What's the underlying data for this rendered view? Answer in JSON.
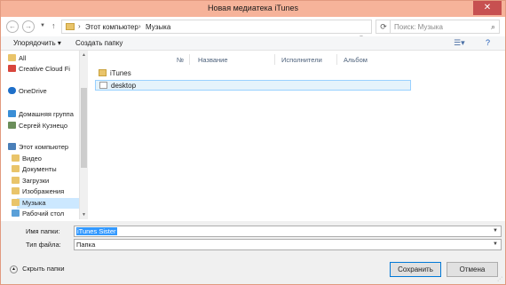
{
  "window": {
    "title": "Новая медиатека iTunes",
    "close_label": "✕"
  },
  "address": {
    "back_icon": "←",
    "forward_icon": "→",
    "breadcrumb": [
      "Этот компьютер",
      "Музыка"
    ],
    "separator": "›",
    "search_placeholder": "Поиск: Музыка"
  },
  "toolbar": {
    "organize_label": "Упорядочить ▾",
    "new_folder_label": "Создать папку"
  },
  "sidebar": {
    "items": [
      {
        "label": "All",
        "icon": "folder-icon"
      },
      {
        "label": "Creative Cloud Fi",
        "icon": "cloud-icon"
      },
      {
        "label": "OneDrive",
        "icon": "onedrive-icon"
      },
      {
        "label": "Домашняя группа",
        "icon": "homegroup-icon"
      },
      {
        "label": "Сергей Кузнецо",
        "icon": "user-icon"
      },
      {
        "label": "Этот компьютер",
        "icon": "computer-icon"
      },
      {
        "label": "Видео",
        "icon": "video-folder-icon"
      },
      {
        "label": "Документы",
        "icon": "documents-folder-icon"
      },
      {
        "label": "Загрузки",
        "icon": "downloads-folder-icon"
      },
      {
        "label": "Изображения",
        "icon": "pictures-folder-icon"
      },
      {
        "label": "Музыка",
        "icon": "music-folder-icon"
      },
      {
        "label": "Рабочий стол",
        "icon": "desktop-folder-icon"
      }
    ]
  },
  "filelist": {
    "columns": [
      "№",
      "Название",
      "Исполнители",
      "Альбом"
    ],
    "rows": [
      {
        "name": "iTunes",
        "icon": "folder-icon",
        "selected": false
      },
      {
        "name": "desktop",
        "icon": "file-icon",
        "selected": true
      }
    ]
  },
  "fields": {
    "filename_label": "Имя папки:",
    "filename_value": "iTunes Sister",
    "filetype_label": "Тип файла:",
    "filetype_value": "Папка"
  },
  "footer": {
    "hide_folders_label": "Скрыть папки",
    "save_label": "Сохранить",
    "cancel_label": "Отмена"
  },
  "colors": {
    "titlebar": "#f6b39a",
    "close": "#c75050",
    "selection": "#cce8ff",
    "accent": "#0078d7"
  }
}
